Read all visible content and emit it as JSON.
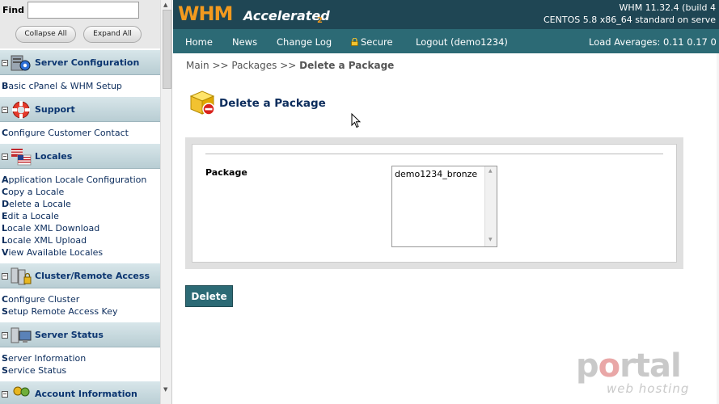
{
  "sidebar": {
    "find_label": "Find",
    "find_value": "",
    "collapse_label": "Collapse All",
    "expand_label": "Expand All",
    "sections": [
      {
        "title": "Server Configuration",
        "icon": "gear-icon",
        "links": [
          "Basic cPanel & WHM Setup"
        ]
      },
      {
        "title": "Support",
        "icon": "lifebuoy-icon",
        "links": [
          "Configure Customer Contact"
        ]
      },
      {
        "title": "Locales",
        "icon": "flag-icon",
        "links": [
          "Application Locale Configuration",
          "Copy a Locale",
          "Delete a Locale",
          "Edit a Locale",
          "Locale XML Download",
          "Locale XML Upload",
          "View Available Locales"
        ]
      },
      {
        "title": "Cluster/Remote Access",
        "icon": "servers-lock-icon",
        "links": [
          "Configure Cluster",
          "Setup Remote Access Key"
        ]
      },
      {
        "title": "Server Status",
        "icon": "monitor-icon",
        "links": [
          "Server Information",
          "Service Status"
        ]
      },
      {
        "title": "Account Information",
        "icon": "users-icon",
        "links": []
      }
    ],
    "toggle_symbol": "−"
  },
  "header": {
    "logo_whm": "WHM",
    "logo_accelerated": "Accelerated",
    "logo_sub": "2",
    "version_line": "WHM 11.32.4 (build 4",
    "os_line": "CENTOS 5.8 x86_64 standard on serve"
  },
  "nav": {
    "items": [
      "Home",
      "News",
      "Change Log",
      "Secure",
      "Logout (demo1234)"
    ],
    "load_averages": "Load Averages: 0.11 0.17 0"
  },
  "breadcrumb": {
    "path": "Main >> Packages >> ",
    "current": "Delete a Package"
  },
  "page": {
    "title": "Delete a Package",
    "package_label": "Package",
    "packages": [
      "demo1234_bronze"
    ],
    "delete_button": "Delete"
  },
  "watermark": {
    "brand_a": "p",
    "brand_accent": "o",
    "brand_b": "rtal",
    "sub": "web hosting"
  },
  "colors": {
    "topbar": "#1f4654",
    "navbar": "#2c6a75",
    "logo_orange": "#f29a1f",
    "link_blue": "#0b2c5c"
  }
}
